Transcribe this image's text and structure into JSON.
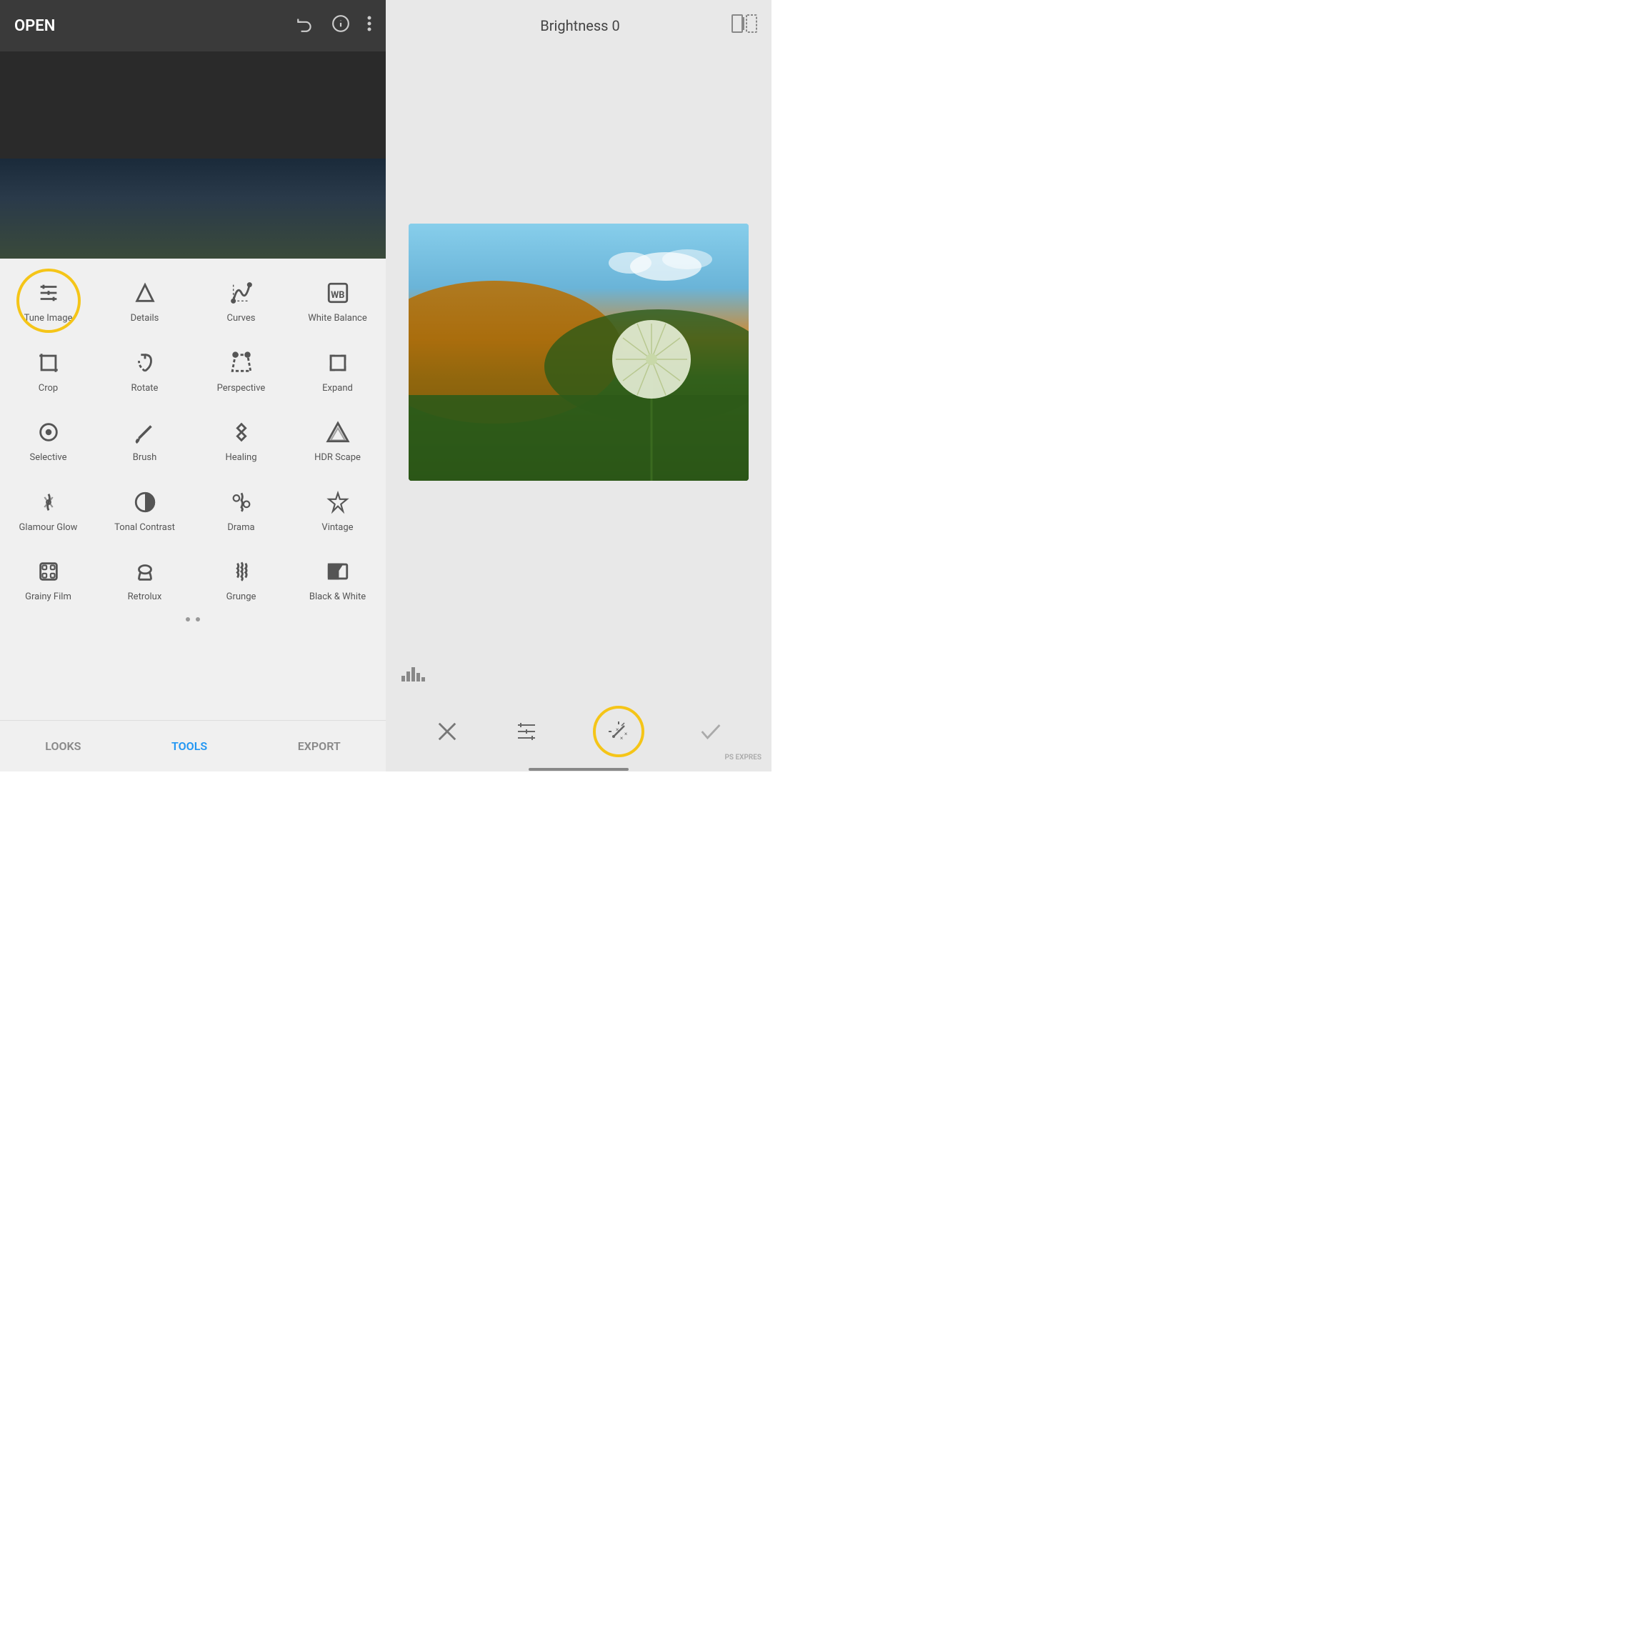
{
  "left": {
    "header": {
      "open_label": "OPEN"
    },
    "tools_rows": [
      [
        {
          "id": "tune-image",
          "label": "Tune Image",
          "icon": "tune"
        },
        {
          "id": "details",
          "label": "Details",
          "icon": "details"
        },
        {
          "id": "curves",
          "label": "Curves",
          "icon": "curves"
        },
        {
          "id": "white-balance",
          "label": "White Balance",
          "icon": "wb"
        }
      ],
      [
        {
          "id": "crop",
          "label": "Crop",
          "icon": "crop"
        },
        {
          "id": "rotate",
          "label": "Rotate",
          "icon": "rotate"
        },
        {
          "id": "perspective",
          "label": "Perspective",
          "icon": "perspective"
        },
        {
          "id": "expand",
          "label": "Expand",
          "icon": "expand"
        }
      ],
      [
        {
          "id": "selective",
          "label": "Selective",
          "icon": "selective"
        },
        {
          "id": "brush",
          "label": "Brush",
          "icon": "brush"
        },
        {
          "id": "healing",
          "label": "Healing",
          "icon": "healing"
        },
        {
          "id": "hdr-scape",
          "label": "HDR Scape",
          "icon": "hdr"
        }
      ],
      [
        {
          "id": "glamour-glow",
          "label": "Glamour Glow",
          "icon": "glamour"
        },
        {
          "id": "tonal-contrast",
          "label": "Tonal Contrast",
          "icon": "tonal"
        },
        {
          "id": "drama",
          "label": "Drama",
          "icon": "drama"
        },
        {
          "id": "vintage",
          "label": "Vintage",
          "icon": "vintage"
        }
      ],
      [
        {
          "id": "grainy-film",
          "label": "Grainy Film",
          "icon": "grainy"
        },
        {
          "id": "retrolux",
          "label": "Retrolux",
          "icon": "retrolux"
        },
        {
          "id": "grunge",
          "label": "Grunge",
          "icon": "grunge"
        },
        {
          "id": "black-white",
          "label": "Black & White",
          "icon": "bw"
        }
      ]
    ],
    "nav_tabs": [
      {
        "id": "looks",
        "label": "LOOKS",
        "active": false
      },
      {
        "id": "tools",
        "label": "TOOLS",
        "active": true
      },
      {
        "id": "export",
        "label": "EXPORT",
        "active": false
      }
    ]
  },
  "right": {
    "header": {
      "brightness_label": "Brightness 0"
    },
    "toolbar": {
      "cancel_label": "×",
      "confirm_label": "✓"
    }
  }
}
